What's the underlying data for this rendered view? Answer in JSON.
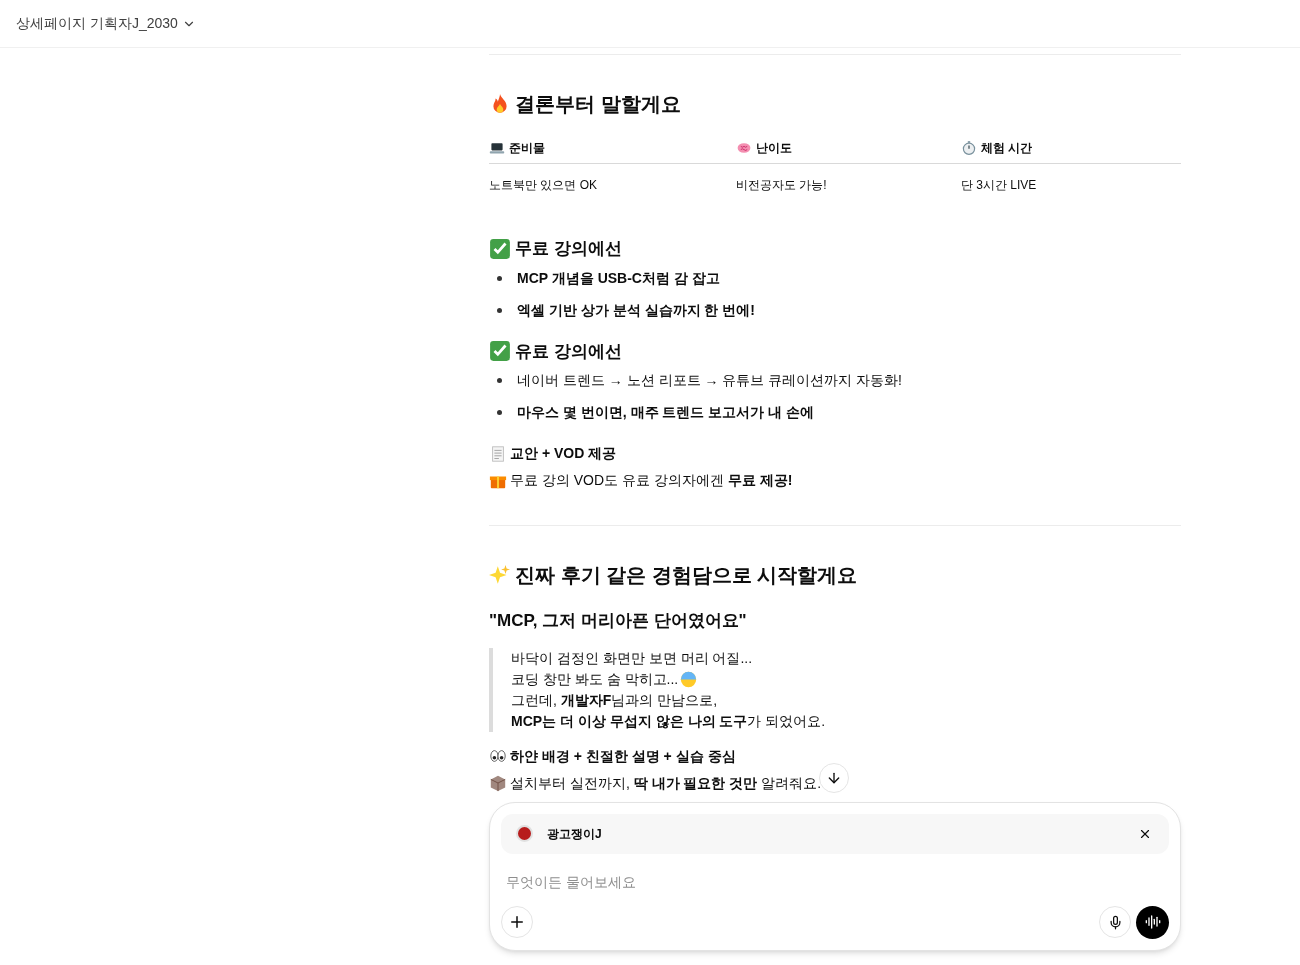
{
  "header": {
    "title": "상세페이지 기획자J_2030"
  },
  "summary": {
    "heading": "결론부터 말할게요",
    "columns": [
      {
        "kind": "laptop",
        "label": "준비물",
        "value": "노트북만 있으면 OK"
      },
      {
        "kind": "brain",
        "label": "난이도",
        "value": "비전공자도 가능!"
      },
      {
        "kind": "stopwatch",
        "label": "체험 시간",
        "value": "단 3시간 LIVE"
      }
    ]
  },
  "lists": [
    {
      "heading": "무료 강의에선",
      "items": [
        {
          "text": "MCP 개념을 USB-C처럼 감 잡고",
          "bold": true
        },
        {
          "text": "엑셀 기반 상가 분석 실습까지 한 번에!",
          "bold": true
        }
      ]
    },
    {
      "heading": "유료 강의에선",
      "items": [
        {
          "text": "네이버 트렌드 → 노션 리포트 → 유튜브 큐레이션까지 자동화!",
          "bold": false
        },
        {
          "text": "마우스 몇 번이면, 매주 트렌드 보고서가 내 손에",
          "bold": true
        }
      ]
    }
  ],
  "extras": [
    {
      "kind": "memo",
      "text": "교안 + VOD 제공",
      "bold": true
    },
    {
      "kind": "gift",
      "text": "무료 강의 VOD도 유료 강의자에겐 **무료 제공!**",
      "bold": false
    }
  ],
  "story": {
    "heading": "진짜 후기 같은 경험담으로 시작할게요",
    "subheading": "\"MCP, 그저 머리아픈 단어였어요\"",
    "quote": [
      {
        "kind": "plain",
        "text": "바닥이 검정인 화면만 보면 머리 어질..."
      },
      {
        "kind": "anxious",
        "text": "코딩 창만 봐도 숨 막히고..."
      },
      {
        "kind": "plain",
        "text": "그런데, **개발자F**님과의 만남으로,"
      },
      {
        "kind": "plain",
        "text": "**MCP는 더 이상 무섭지 않은 나의 도구**가 되었어요."
      }
    ],
    "features": [
      {
        "kind": "eyes",
        "text": "하얀 배경 + 친절한 설명 + 실습 중심",
        "bold": true
      },
      {
        "kind": "package",
        "text": "설치부터 실전까지, **딱 내가 필요한 것만** 알려줘요.",
        "bold": false
      }
    ]
  },
  "composer": {
    "gpt_name": "광고쟁이J",
    "placeholder": "무엇이든 물어보세요"
  }
}
